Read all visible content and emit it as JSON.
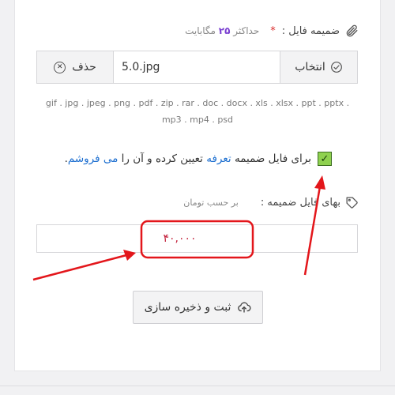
{
  "attachment": {
    "label": "ضمیمه فایل :",
    "required_mark": "*",
    "max_prefix": "حداکثر",
    "max_number": "۲۵",
    "max_unit": "مگابایت"
  },
  "file_input": {
    "delete_label": "حذف",
    "file_name": "5.0.jpg",
    "select_label": "انتخاب"
  },
  "formats_text": "gif . jpg . jpeg . png . pdf . zip . rar . doc . docx . xls . xlsx . ppt . pptx . mp3 . mp4 . psd",
  "tariff_checkbox": {
    "checked": true,
    "text_before": "برای فایل ضمیمه",
    "link_tariff": "تعرفه",
    "text_middle": "تعیین کرده و آن را",
    "link_sell": "می فروشم",
    "text_end": "."
  },
  "price": {
    "label": "بهای فایل ضمیمه :",
    "unit_hint": "بر حسب تومان",
    "value": "۴۰,۰۰۰"
  },
  "save_button": {
    "label": "ثبت و ذخیره سازی"
  },
  "colors": {
    "annotation": "#e3161b",
    "link": "#1d6fd0",
    "price": "#c21f3a"
  }
}
